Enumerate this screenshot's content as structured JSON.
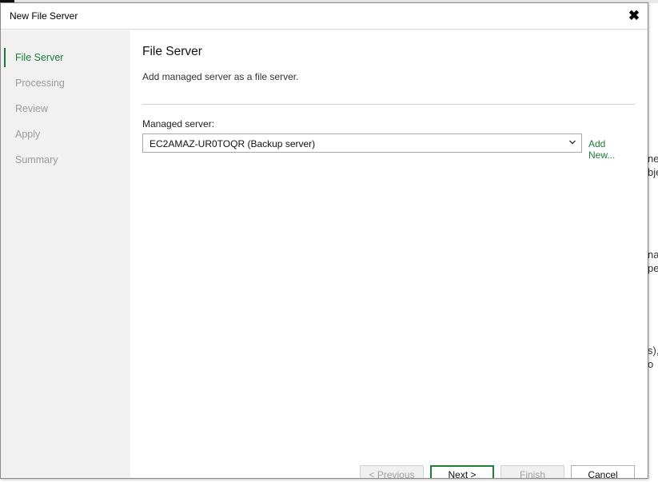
{
  "dialog": {
    "title": "New File Server",
    "close_glyph": "✖"
  },
  "steps": [
    {
      "label": "File Server",
      "active": true
    },
    {
      "label": "Processing",
      "active": false
    },
    {
      "label": "Review",
      "active": false
    },
    {
      "label": "Apply",
      "active": false
    },
    {
      "label": "Summary",
      "active": false
    }
  ],
  "page": {
    "title": "File Server",
    "description": "Add managed server as a file server."
  },
  "managed_server": {
    "label": "Managed server:",
    "value": "EC2AMAZ-UR0TOQR (Backup server)",
    "add_new_label": "Add New..."
  },
  "buttons": {
    "previous": "< Previous",
    "next": "Next >",
    "finish": "Finish",
    "cancel": "Cancel"
  },
  "background_fragments": [
    "ne",
    "bje",
    "na",
    "pe",
    "s),",
    "o"
  ],
  "colors": {
    "accent": "#1e7e34",
    "sidebar_bg": "#f1f1f1",
    "inactive_step": "#9a9a9a"
  },
  "icons": {
    "close": "close-icon",
    "dropdown": "chevron-down-icon"
  }
}
